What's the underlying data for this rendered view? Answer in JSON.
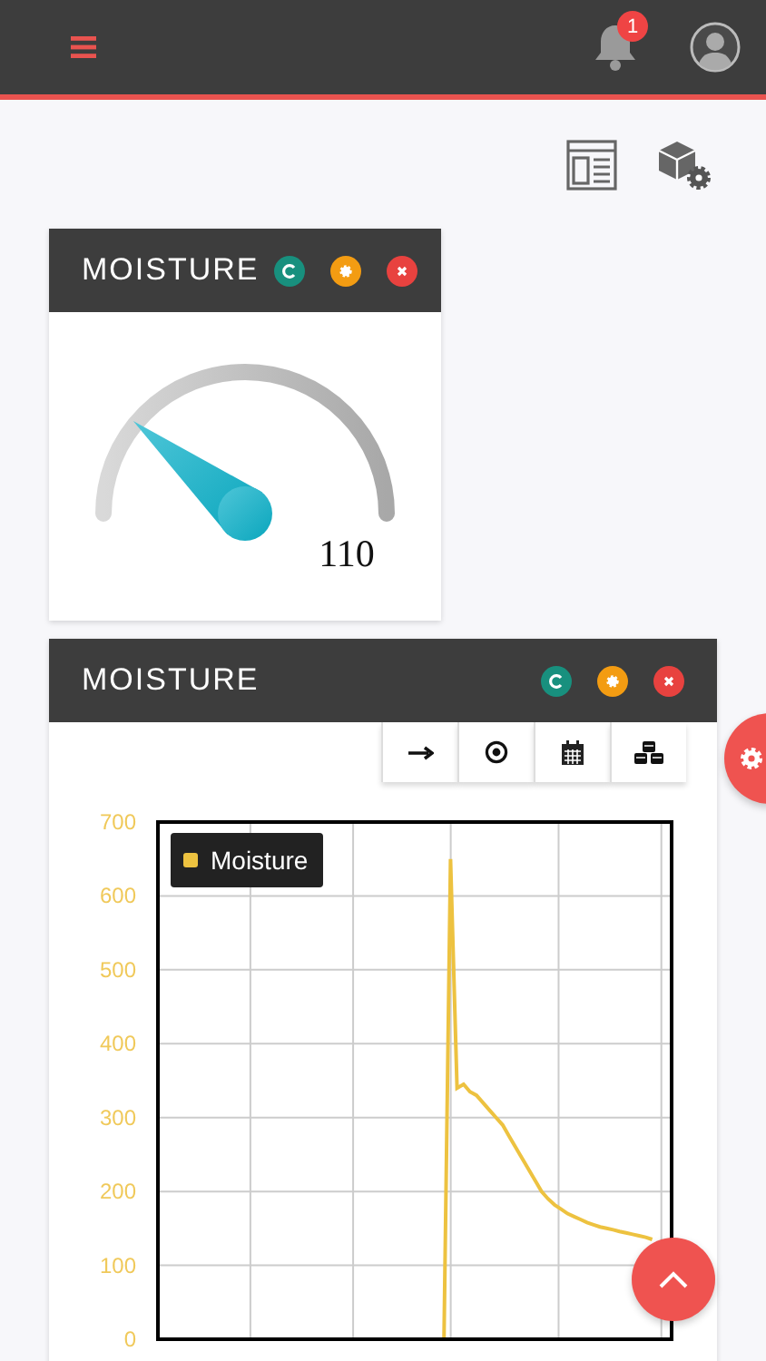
{
  "top_bar": {
    "notification_count": "1"
  },
  "widgets": [
    {
      "kind": "gauge",
      "title": "MOISTURE",
      "value": "110",
      "level": 0.22
    },
    {
      "kind": "chart",
      "title": "MOISTURE",
      "chart_data": {
        "type": "line",
        "grid": true,
        "ylim": [
          0,
          700
        ],
        "yticks": [
          0,
          100,
          200,
          300,
          400,
          500,
          600,
          700
        ],
        "categories": [
          null,
          null,
          null,
          null,
          null,
          null,
          null,
          null,
          null,
          null,
          null,
          null,
          null,
          null,
          null,
          null,
          null,
          null,
          null,
          null,
          null,
          null,
          null,
          null,
          null,
          null,
          null,
          null,
          null,
          null,
          null,
          null,
          null,
          null,
          null,
          null,
          null,
          null,
          null,
          null,
          null,
          null,
          null,
          null,
          null,
          null,
          null,
          null,
          null,
          null,
          null,
          null,
          null,
          null,
          null,
          null,
          null,
          null,
          null,
          null,
          null,
          null,
          null,
          null,
          null,
          null,
          null,
          null,
          null,
          null,
          null,
          null,
          null,
          null,
          null,
          null,
          null,
          null,
          null,
          null
        ],
        "series": [
          {
            "name": "Moisture",
            "color": "#edc240",
            "values": [
              null,
              null,
              null,
              null,
              null,
              null,
              null,
              null,
              null,
              null,
              null,
              null,
              null,
              null,
              null,
              null,
              null,
              null,
              null,
              null,
              null,
              null,
              null,
              null,
              null,
              null,
              null,
              null,
              null,
              null,
              null,
              null,
              null,
              null,
              null,
              null,
              null,
              null,
              null,
              null,
              null,
              null,
              null,
              null,
              0,
              650,
              340,
              345,
              335,
              330,
              320,
              310,
              300,
              290,
              275,
              260,
              245,
              230,
              215,
              200,
              190,
              182,
              176,
              170,
              166,
              162,
              158,
              155,
              152,
              150,
              148,
              146,
              144,
              142,
              140,
              138,
              135,
              null,
              null,
              null
            ]
          }
        ]
      }
    }
  ]
}
